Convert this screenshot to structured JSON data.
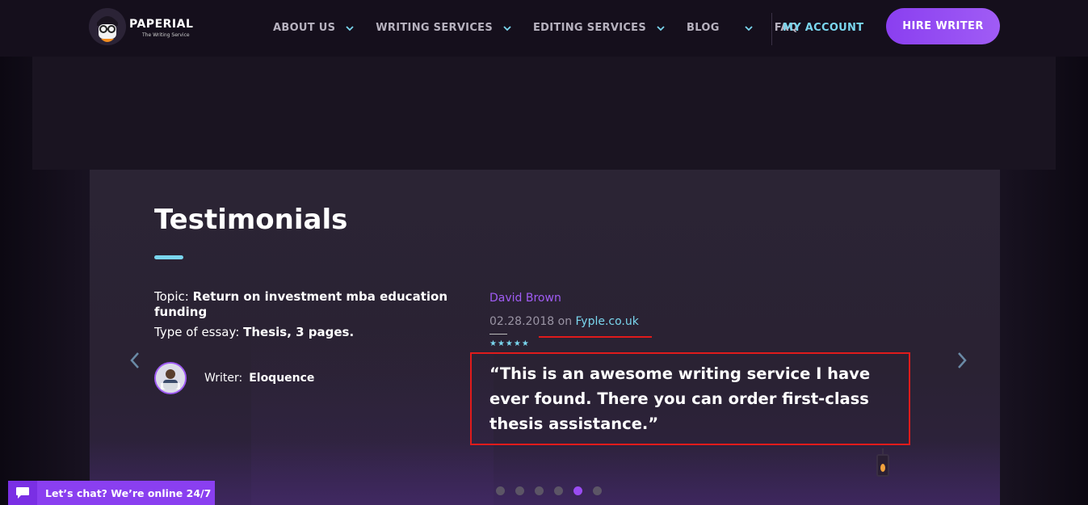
{
  "header": {
    "logo_text": "PAPERIAL",
    "logo_sub": "The Writing Service",
    "nav": [
      {
        "label": "ABOUT US",
        "has_dropdown": true
      },
      {
        "label": "WRITING SERVICES",
        "has_dropdown": true
      },
      {
        "label": "EDITING SERVICES",
        "has_dropdown": true
      },
      {
        "label": "BLOG",
        "has_dropdown": true
      },
      {
        "label": "FAQ",
        "has_dropdown": false
      }
    ],
    "my_account": "MY ACCOUNT",
    "hire_writer": "HIRE WRITER"
  },
  "testimonials": {
    "title": "Testimonials",
    "topic_label": "Topic: ",
    "topic_value": "Return on investment mba education funding",
    "essay_label": "Type of essay: ",
    "essay_value": "Thesis, 3 pages.",
    "writer_label": "Writer:",
    "writer_name": "Eloquence",
    "author": "David Brown",
    "date": "02.28.2018",
    "on_label": " on ",
    "site": "Fyple.co.uk",
    "stars": "★★★★★",
    "quote": "“This is an awesome writing service I have ever found. There you can order first-class thesis assistance.”",
    "active_slide": 5,
    "slide_count": 6
  },
  "chat": {
    "label": "Let’s chat? We’re online 24/7"
  },
  "colors": {
    "accent_purple": "#8a3ff0",
    "accent_cyan": "#7ad6ee",
    "highlight_red": "#e01b1b"
  }
}
